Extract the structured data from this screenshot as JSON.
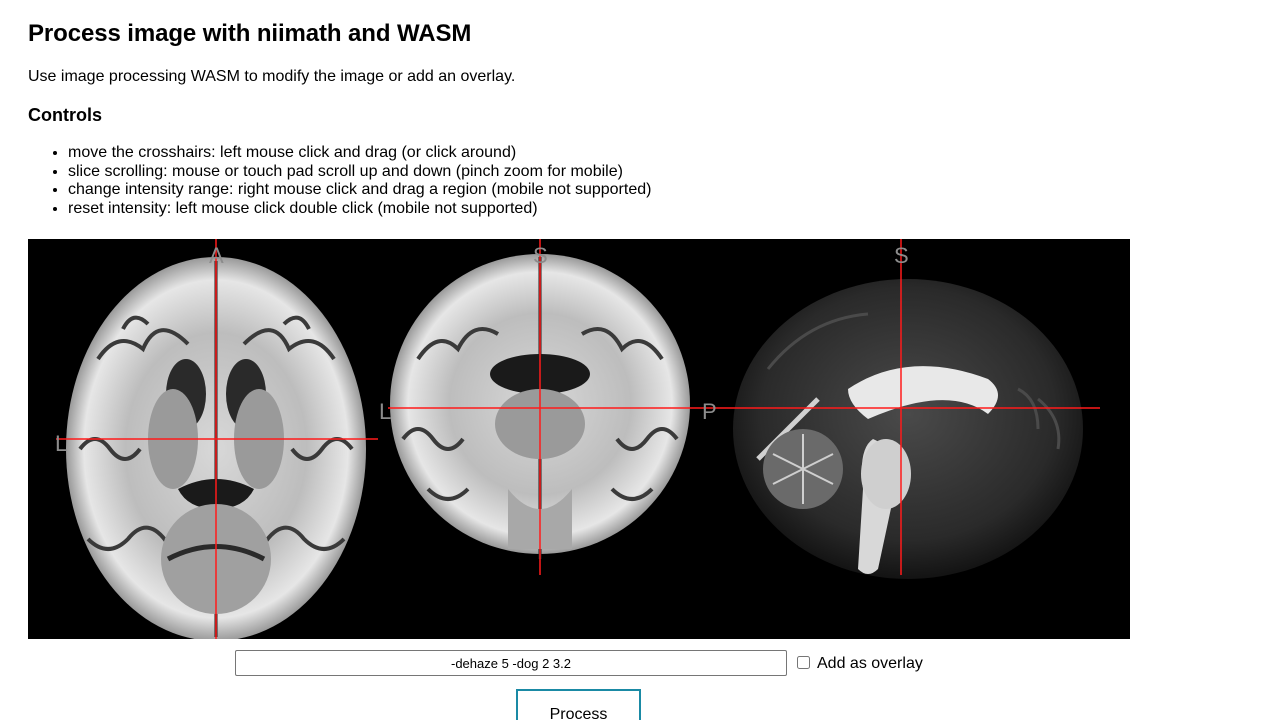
{
  "page": {
    "title": "Process image with niimath and WASM",
    "description": "Use image processing WASM to modify the image or add an overlay.",
    "controls_heading": "Controls",
    "controls": [
      "move the crosshairs: left mouse click and drag (or click around)",
      "slice scrolling: mouse or touch pad scroll up and down (pinch zoom for mobile)",
      "change intensity range: right mouse click and drag a region (mobile not supported)",
      "reset intensity: left mouse click double click (mobile not supported)"
    ]
  },
  "viewer": {
    "crosshair_color": "#ff1a1a",
    "background": "#000000",
    "axial_labels": {
      "top": "A",
      "left": "L"
    },
    "coronal_labels": {
      "top": "S",
      "left": "L"
    },
    "sagittal_labels": {
      "top": "S",
      "left": "P"
    }
  },
  "form": {
    "command_value": "-dehaze 5 -dog 2 3.2",
    "overlay_checked": false,
    "overlay_label": "Add as overlay",
    "process_label": "Process"
  },
  "colors": {
    "accent": "#1a8aa5"
  }
}
